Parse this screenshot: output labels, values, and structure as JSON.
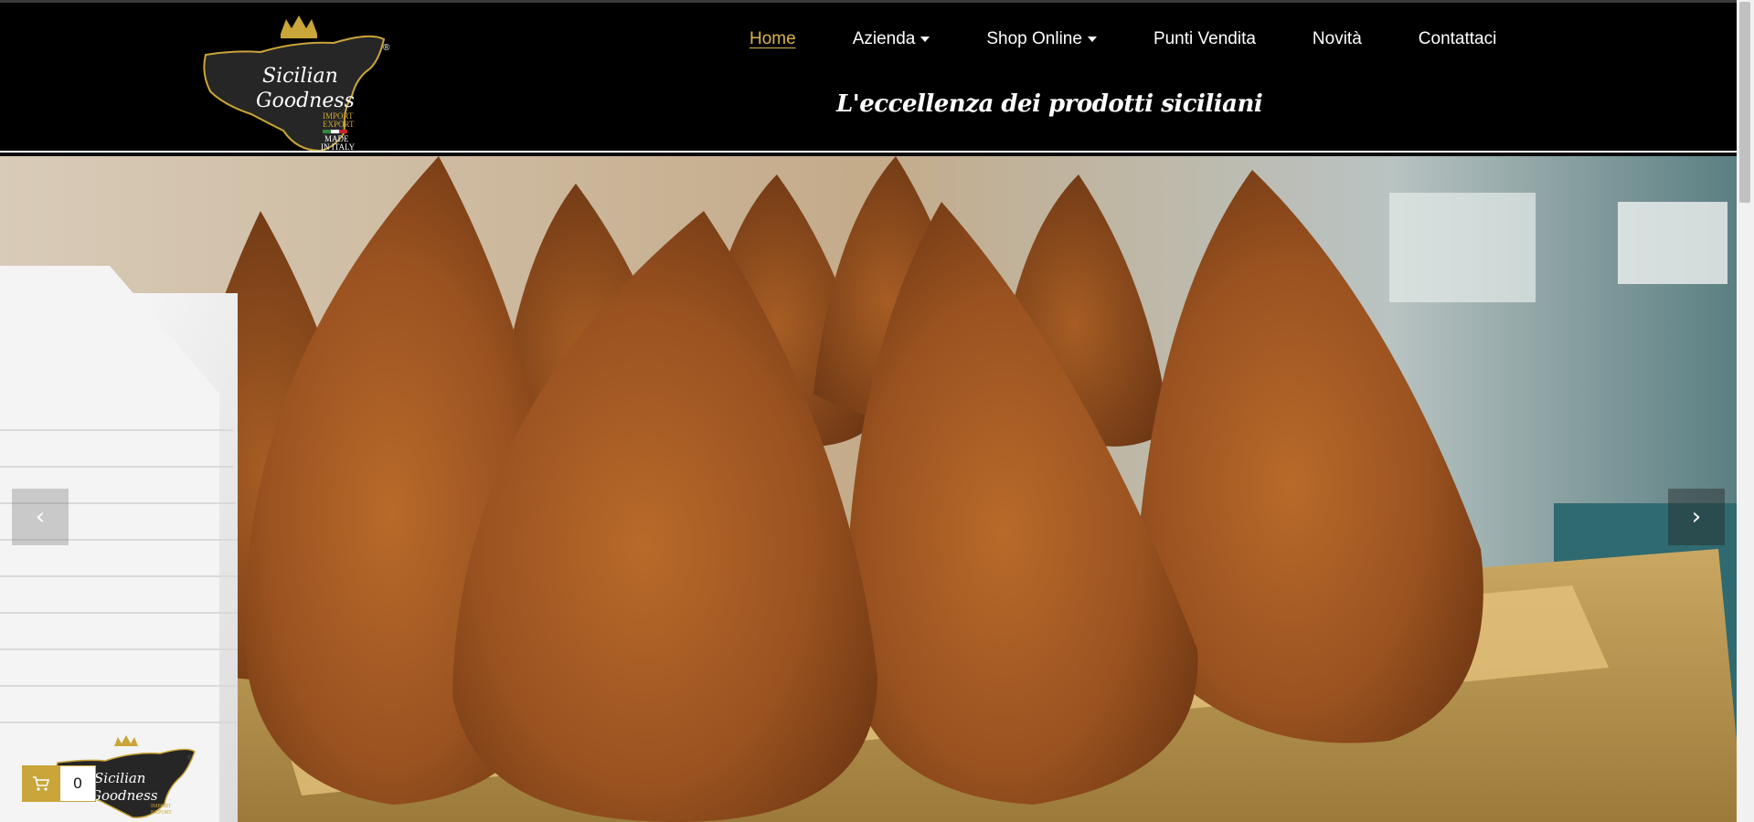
{
  "brand": {
    "logo_line1": "Sicilian",
    "logo_line2": "Goodness",
    "logo_line3": "IMPORT",
    "logo_line4": "EXPORT",
    "logo_line5": "MADE",
    "logo_line6": "IN ITALY",
    "registered": "®"
  },
  "nav": {
    "items": [
      {
        "label": "Home",
        "active": true
      },
      {
        "label": "Azienda",
        "dropdown": true
      },
      {
        "label": "Shop Online",
        "dropdown": true
      },
      {
        "label": "Punti Vendita"
      },
      {
        "label": "Novità"
      },
      {
        "label": "Contattaci"
      }
    ]
  },
  "tagline": "L'eccellenza dei prodotti siciliani",
  "slider": {
    "prev_icon": "‹",
    "next_icon": "›"
  },
  "cart": {
    "count": "0"
  },
  "colors": {
    "header_bg": "#000000",
    "accent_gold": "#d9b44a",
    "cart_gold": "#c9a53a"
  }
}
